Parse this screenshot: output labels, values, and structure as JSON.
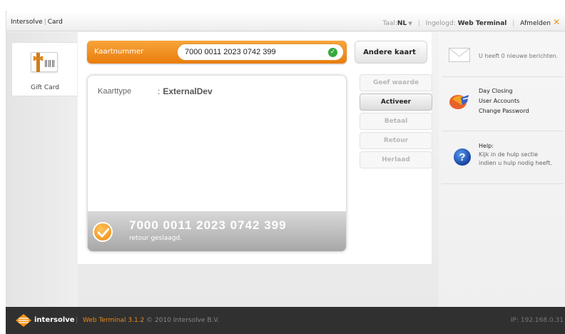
{
  "header": {
    "brand": "Intersolve",
    "section": "Card",
    "language_label": "Taal:",
    "language_value": "NL",
    "logged_in_label": "Ingelogd:",
    "logged_in_user": "Web Terminal",
    "logout_label": "Afmelden"
  },
  "left": {
    "product_label": "Gift Card"
  },
  "card": {
    "field_label": "Kaartnummer",
    "number": "7000 0011 2023 0742 399",
    "other_card_button": "Andere kaart"
  },
  "details": {
    "type_label": "Kaarttype",
    "type_value": "ExternalDev",
    "result_number": "7000 0011 2023 0742 399",
    "result_message": "retour geslaagd."
  },
  "actions": [
    {
      "label": "Geef waarde",
      "state": "disabled"
    },
    {
      "label": "Activeer",
      "state": "active"
    },
    {
      "label": "Betaal",
      "state": "disabled"
    },
    {
      "label": "Retour",
      "state": "disabled"
    },
    {
      "label": "Herlaad",
      "state": "disabled"
    }
  ],
  "right": {
    "messages_text": "U heeft 0 nieuwe berichten.",
    "links": [
      "Day Closing",
      "User Accounts",
      "Change Password"
    ],
    "help_title": "Help:",
    "help_text_1": "Kijk in de hulp sectie",
    "help_text_2": "indien u hulp nodig heeft."
  },
  "footer": {
    "brand": "intersolve",
    "product": "Web Terminal 3.1.2",
    "copyright": "© 2010 Intersolve B.V.",
    "ip": "IP: 192.168.0.31"
  },
  "colors": {
    "accent": "#ea7d0c",
    "success_green": "#38a83d",
    "footer_bg": "#303030",
    "help_blue": "#1f5fc8"
  },
  "icons": [
    "gift-card-icon",
    "check-circle-icon",
    "close-icon",
    "envelope-icon",
    "tools-icon",
    "help-icon",
    "intersolve-logo-icon"
  ]
}
